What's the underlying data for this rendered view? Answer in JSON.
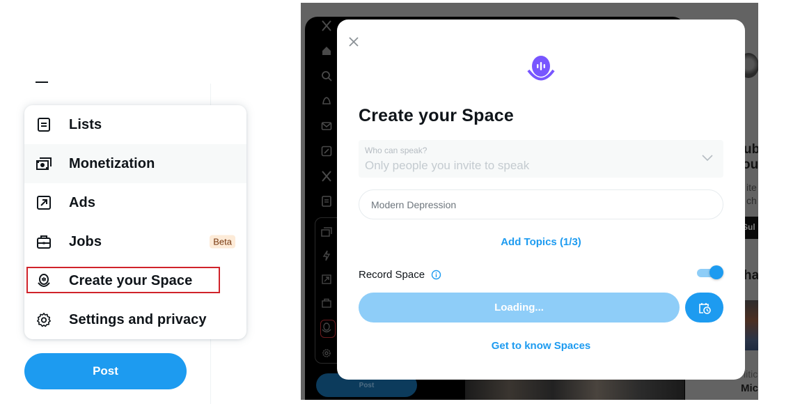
{
  "left_menu": {
    "items": [
      {
        "label": "Lists",
        "icon": "list-icon"
      },
      {
        "label": "Monetization",
        "icon": "money-icon"
      },
      {
        "label": "Ads",
        "icon": "ads-arrow-icon"
      },
      {
        "label": "Jobs",
        "icon": "briefcase-icon",
        "badge": "Beta"
      },
      {
        "label": "Create your Space",
        "icon": "spaces-icon",
        "highlighted": true
      },
      {
        "label": "Settings and privacy",
        "icon": "gear-icon"
      }
    ],
    "post_label": "Post"
  },
  "background_app": {
    "post_label": "Post",
    "right_column": {
      "heading_fragment_1": "ub",
      "heading_fragment_2": "ou",
      "sub_fragment_1": "ite",
      "sub_fragment_2": "ch",
      "button_fragment": "Sul",
      "section_fragment": "ha",
      "caption_fragment": "litic",
      "name_fragment": "Miche"
    }
  },
  "modal": {
    "title": "Create your Space",
    "who_can_speak": {
      "label": "Who can speak?",
      "value": "Only people you invite to speak"
    },
    "space_name_input": {
      "value": "Modern Depression"
    },
    "add_topics_label": "Add Topics (1/3)",
    "record_space": {
      "label": "Record Space",
      "enabled": true
    },
    "primary_button_label": "Loading...",
    "get_to_know_label": "Get to know Spaces"
  },
  "colors": {
    "accent": "#1d9bf0",
    "spaces_purple": "#7856ff",
    "highlight_red": "#d0232a",
    "beta_bg": "#fdebd8"
  }
}
